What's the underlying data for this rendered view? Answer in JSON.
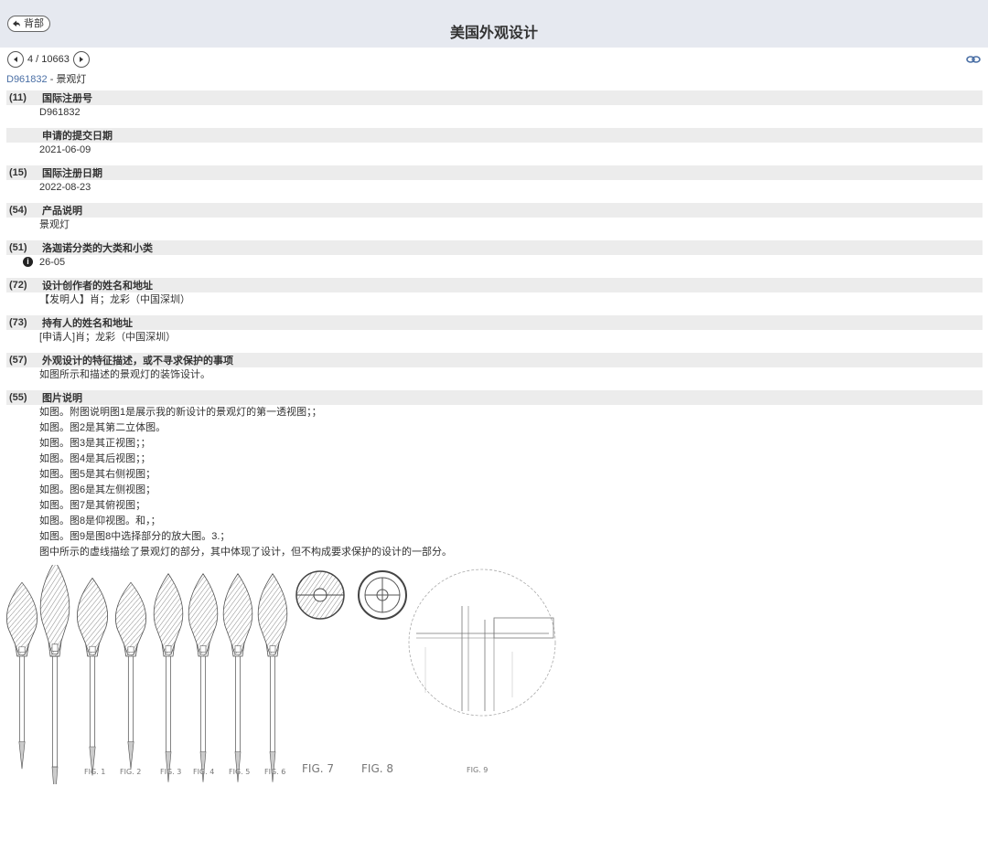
{
  "header": {
    "back_label": "背部",
    "title": "美国外观设计"
  },
  "pager": {
    "position": "4 / 10663"
  },
  "record": {
    "code": "D961832",
    "separator": " - ",
    "name": "景观灯"
  },
  "fields": [
    {
      "num": "(11)",
      "label": "国际注册号",
      "value": "D961832"
    },
    {
      "num": "",
      "label": "申请的提交日期",
      "value": "2021-06-09"
    },
    {
      "num": "(15)",
      "label": "国际注册日期",
      "value": "2022-08-23"
    },
    {
      "num": "(54)",
      "label": "产品说明",
      "value": "景观灯"
    },
    {
      "num": "(51)",
      "label": "洛迦诺分类的大类和小类",
      "value": "26-05"
    },
    {
      "num": "(72)",
      "label": "设计创作者的姓名和地址",
      "value": "【发明人】肖；龙彩（中国深圳）"
    },
    {
      "num": "(73)",
      "label": "持有人的姓名和地址",
      "value": "[申请人]肖；龙彩（中国深圳）"
    },
    {
      "num": "(57)",
      "label": "外观设计的特征描述，或不寻求保护的事项",
      "value": "如图所示和描述的景观灯的装饰设计。"
    },
    {
      "num": "(55)",
      "label": "图片说明",
      "lines": [
        "如图。附图说明图1是展示我的新设计的景观灯的第一透视图；；",
        "如图。图2是其第二立体图。",
        "如图。图3是其正视图；；",
        "如图。图4是其后视图；；",
        "如图。图5是其右侧视图；",
        "如图。图6是其左侧视图；",
        "如图。图7是其俯视图；",
        "如图。图8是仰视图。和，；",
        "如图。图9是图8中选择部分的放大图。3.；",
        "图中所示的虚线描绘了景观灯的部分，其中体现了设计，但不构成要求保护的设计的一部分。"
      ]
    }
  ],
  "figure_labels": [
    "FIG. 1",
    "FIG. 2",
    "FIG. 3",
    "FIG. 4",
    "FIG. 5",
    "FIG. 6",
    "FIG. 7",
    "FIG. 8",
    "FIG. 9"
  ],
  "icons": {
    "back": "back-arrow-icon",
    "prev": "prev-arrow-icon",
    "next": "next-arrow-icon",
    "link": "link-icon",
    "info": "info-icon"
  }
}
